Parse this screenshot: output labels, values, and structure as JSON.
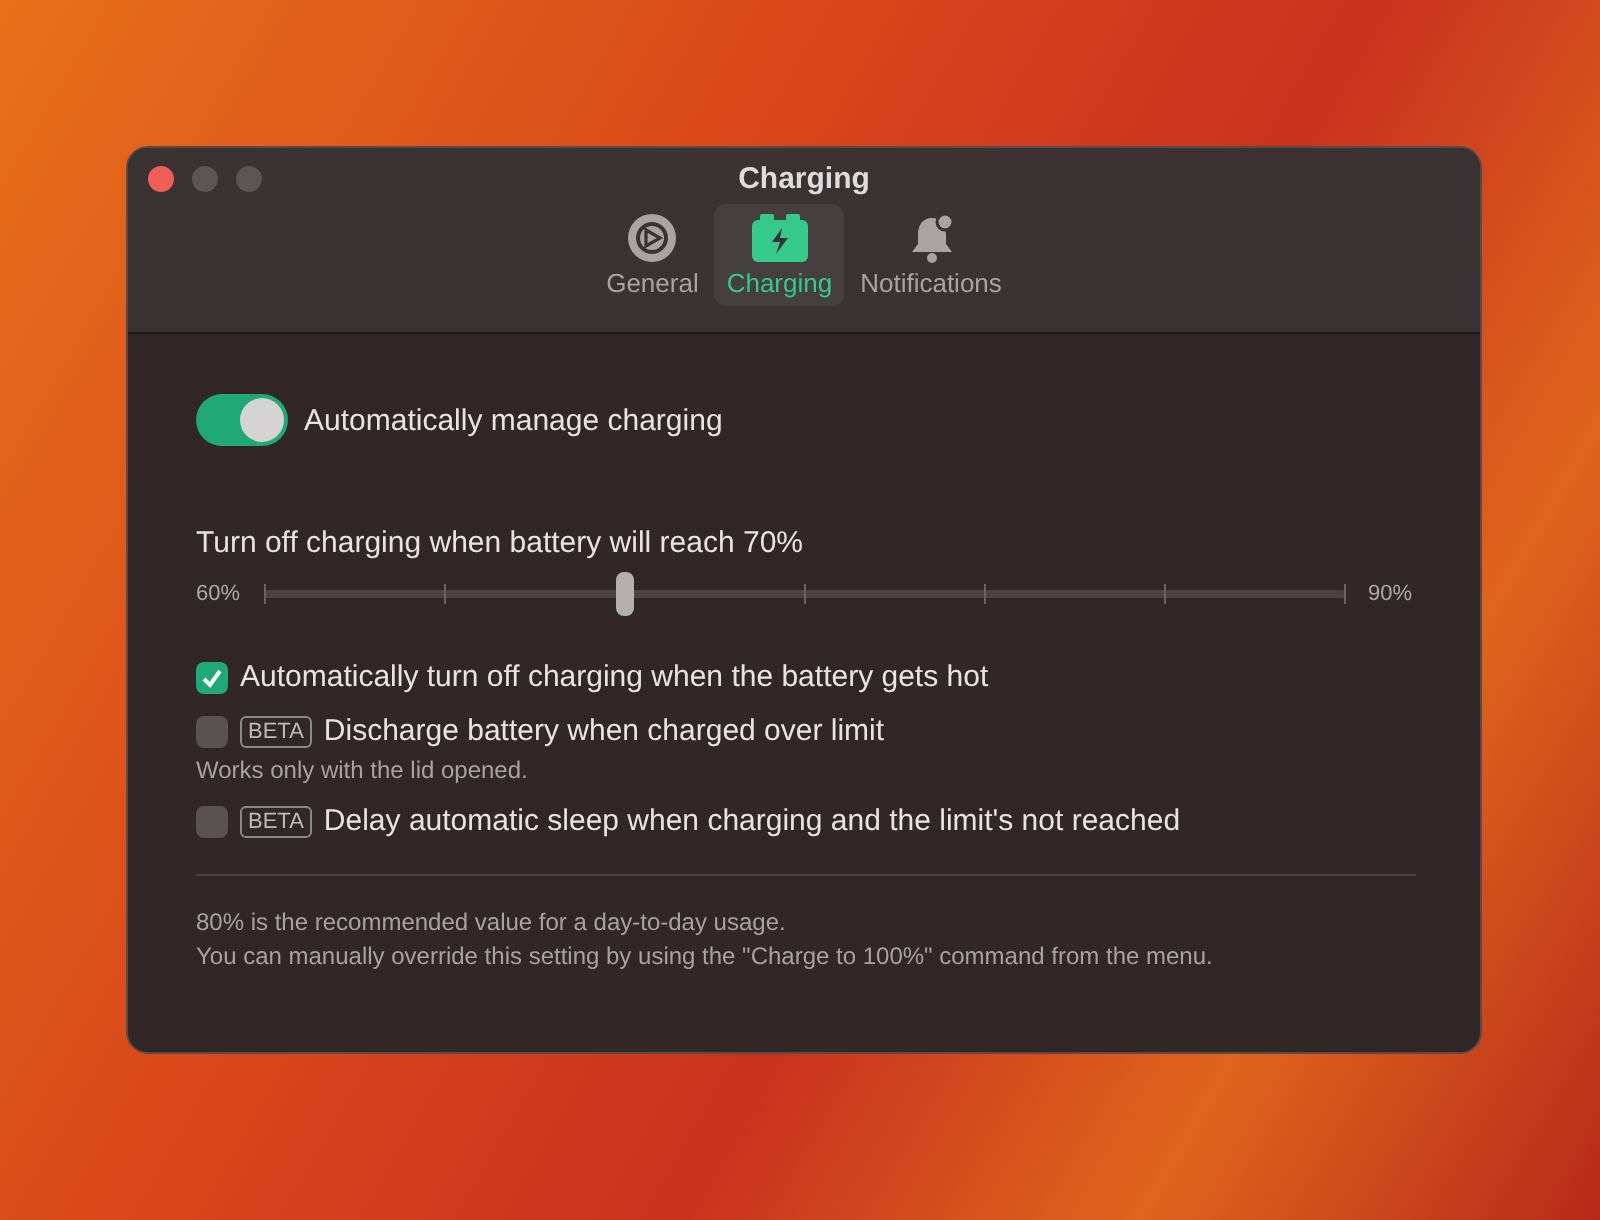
{
  "window": {
    "title": "Charging"
  },
  "tabs": [
    {
      "label": "General",
      "selected": false
    },
    {
      "label": "Charging",
      "selected": true
    },
    {
      "label": "Notifications",
      "selected": false
    }
  ],
  "toggle": {
    "label": "Automatically manage charging",
    "on": true
  },
  "slider": {
    "label": "Turn off charging when battery will reach 70%",
    "min_label": "60%",
    "max_label": "90%",
    "level": 0.333
  },
  "options": [
    {
      "label": "Automatically turn off charging when the battery gets hot",
      "checked": true
    },
    {
      "badge": "BETA",
      "label": "Discharge battery when charged over limit",
      "checked": false,
      "note": "Works only with the lid opened."
    },
    {
      "badge": "BETA",
      "label": "Delay automatic sleep when charging and the limit's not reached",
      "checked": false
    }
  ],
  "footer": [
    "80% is the recommended value for a day-to-day usage.",
    "You can manually override this setting by using the \"Charge to 100%\" command from the menu."
  ]
}
